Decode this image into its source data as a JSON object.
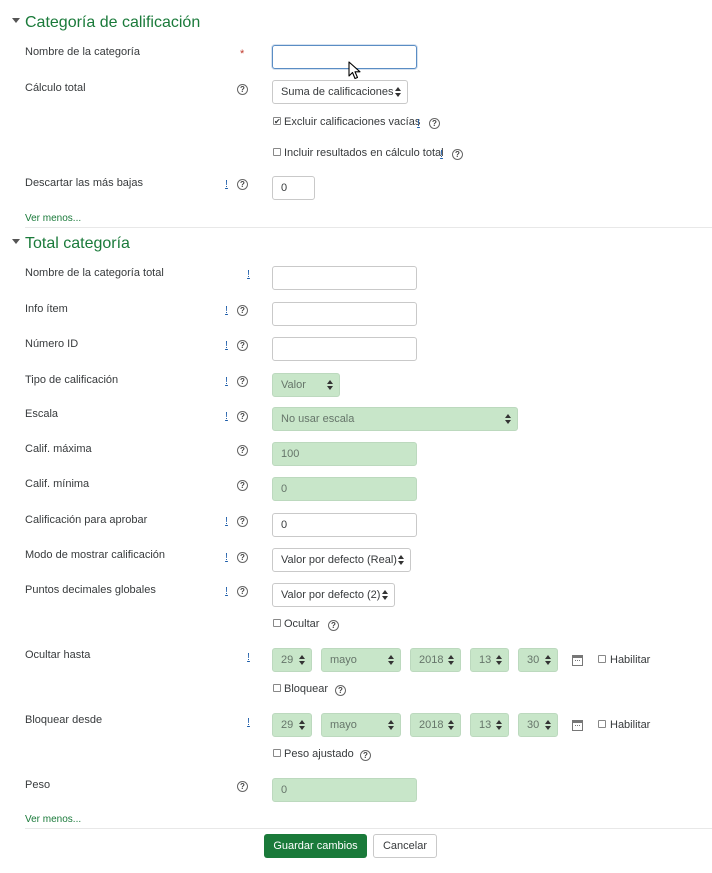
{
  "section1": {
    "title": "Categoría de calificación",
    "fields": {
      "nombre": {
        "label": "Nombre de la categoría",
        "required_mark": "*",
        "value": ""
      },
      "calculo": {
        "label": "Cálculo total",
        "selected": "Suma de calificaciones"
      },
      "excluir": {
        "label": "Excluir calificaciones vacías",
        "checked": true
      },
      "incluir": {
        "label": "Incluir resultados en cálculo total",
        "checked": false
      },
      "descartar": {
        "label": "Descartar las más bajas",
        "value": "0"
      }
    },
    "show_less": "Ver menos..."
  },
  "section2": {
    "title": "Total categoría",
    "fields": {
      "nombre_total": {
        "label": "Nombre de la categoría total",
        "value": ""
      },
      "info_item": {
        "label": "Info ítem",
        "value": ""
      },
      "numero_id": {
        "label": "Número ID",
        "value": ""
      },
      "tipo": {
        "label": "Tipo de calificación",
        "selected": "Valor"
      },
      "escala": {
        "label": "Escala",
        "selected": "No usar escala"
      },
      "max": {
        "label": "Calif. máxima",
        "value": "100"
      },
      "min": {
        "label": "Calif. mínima",
        "value": "0"
      },
      "aprobar": {
        "label": "Calificación para aprobar",
        "value": "0"
      },
      "modo": {
        "label": "Modo de mostrar calificación",
        "selected": "Valor por defecto (Real)"
      },
      "decimales": {
        "label": "Puntos decimales globales",
        "selected": "Valor por defecto (2)"
      },
      "ocultar": {
        "label": "Ocultar",
        "checked": false
      },
      "ocultar_hasta": {
        "label": "Ocultar hasta",
        "day": "29",
        "month": "mayo",
        "year": "2018",
        "hour": "13",
        "minute": "30",
        "enable_label": "Habilitar"
      },
      "bloquear": {
        "label": "Bloquear",
        "checked": false
      },
      "bloquear_desde": {
        "label": "Bloquear desde",
        "day": "29",
        "month": "mayo",
        "year": "2018",
        "hour": "13",
        "minute": "30",
        "enable_label": "Habilitar"
      },
      "peso_ajustado": {
        "label": "Peso ajustado",
        "checked": false
      },
      "peso": {
        "label": "Peso",
        "value": "0"
      }
    },
    "show_less": "Ver menos..."
  },
  "actions": {
    "save": "Guardar cambios",
    "cancel": "Cancelar"
  },
  "icons": {
    "help": "?",
    "advanced": "!",
    "check": "✔"
  },
  "colors": {
    "accent": "#1a7a3a",
    "disabled_bg": "#c8e6c9",
    "required": "#c0392b"
  }
}
